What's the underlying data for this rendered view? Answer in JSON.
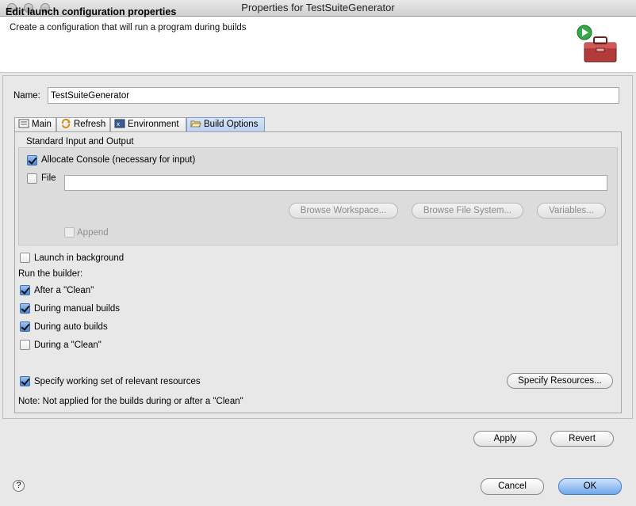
{
  "window": {
    "title": "Properties for TestSuiteGenerator"
  },
  "header": {
    "title": "Edit launch configuration properties",
    "description": "Create a configuration that will run a program during builds"
  },
  "name_field": {
    "label": "Name:",
    "value": "TestSuiteGenerator"
  },
  "tabs": [
    {
      "label": "Main"
    },
    {
      "label": "Refresh"
    },
    {
      "label": "Environment"
    },
    {
      "label": "Build Options"
    }
  ],
  "build_options": {
    "io_group_label": "Standard Input and Output",
    "allocate_console": {
      "label": "Allocate Console (necessary for input)",
      "checked": true
    },
    "file": {
      "label": "File",
      "checked": false,
      "value": ""
    },
    "browse_workspace_label": "Browse Workspace...",
    "browse_filesystem_label": "Browse File System...",
    "variables_label": "Variables...",
    "append": {
      "label": "Append",
      "checked": false
    },
    "launch_background": {
      "label": "Launch in background",
      "checked": false
    },
    "run_builder_label": "Run the builder:",
    "after_clean": {
      "label": "After a \"Clean\"",
      "checked": true
    },
    "during_manual": {
      "label": "During manual builds",
      "checked": true
    },
    "during_auto": {
      "label": "During auto builds",
      "checked": true
    },
    "during_clean": {
      "label": "During a \"Clean\"",
      "checked": false
    },
    "working_set": {
      "label": "Specify working set of relevant resources",
      "checked": true
    },
    "specify_resources_label": "Specify Resources...",
    "note": "Note: Not applied for the builds during or after a \"Clean\""
  },
  "actions": {
    "apply_label": "Apply",
    "revert_label": "Revert",
    "cancel_label": "Cancel",
    "ok_label": "OK"
  },
  "help": {
    "glyph": "?"
  }
}
